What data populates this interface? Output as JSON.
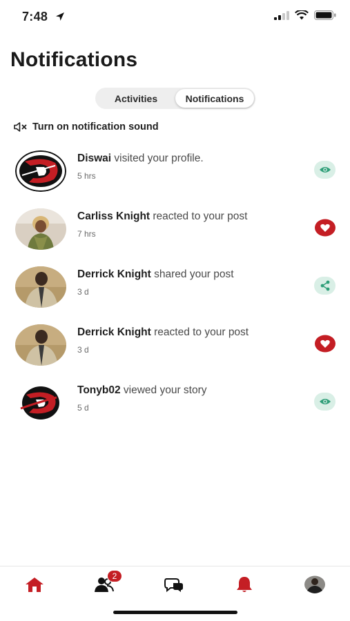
{
  "status_bar": {
    "time": "7:48"
  },
  "header": {
    "title": "Notifications"
  },
  "tabs": [
    {
      "label": "Activities",
      "active": false
    },
    {
      "label": "Notifications",
      "active": true
    }
  ],
  "sound_toggle": {
    "label": "Turn on notification sound"
  },
  "notifications": [
    {
      "name": "Diswai",
      "action": " visited your profile.",
      "time": "5 hrs",
      "icon": "eye-icon",
      "avatar": "logo-d"
    },
    {
      "name": "Carliss Knight",
      "action": " reacted to your post",
      "time": "7 hrs",
      "icon": "heart-icon",
      "avatar": "photo-woman"
    },
    {
      "name": "Derrick Knight",
      "action": " shared your post",
      "time": "3 d",
      "icon": "share-icon",
      "avatar": "photo-man"
    },
    {
      "name": "Derrick Knight",
      "action": " reacted to your post",
      "time": "3 d",
      "icon": "heart-icon",
      "avatar": "photo-man"
    },
    {
      "name": "Tonyb02",
      "action": " viewed your story",
      "time": "5 d",
      "icon": "eye-icon",
      "avatar": "logo-d"
    }
  ],
  "bottom_nav": {
    "items": [
      "home-icon",
      "friends-icon",
      "chat-icon",
      "bell-icon",
      "profile-avatar"
    ],
    "friends_badge": "2"
  },
  "colors": {
    "brand_red": "#c41e24",
    "accent_green": "#2e9e78",
    "mint_bg": "#d9efe6"
  }
}
